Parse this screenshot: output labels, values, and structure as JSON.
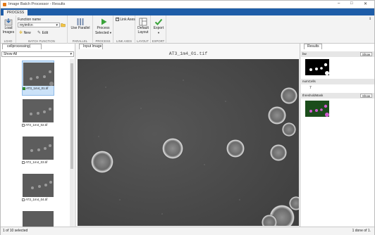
{
  "window": {
    "title": "Image Batch Processor - Results"
  },
  "toolstrip_tab": "PROCESS",
  "ribbon": {
    "load": {
      "button": "Load Images",
      "section": "LOAD"
    },
    "batch_function": {
      "label": "Function name",
      "value": "myimfcn",
      "new": "New",
      "edit": "Edit",
      "section": "BATCH FUNCTION"
    },
    "parallel": {
      "button": "Use Parallel",
      "section": "PARALLEL"
    },
    "process": {
      "button": "Process Selected",
      "section": "PROCESS"
    },
    "link_axes": {
      "label": "Link Axes",
      "checked": true,
      "section": "LINK AXES"
    },
    "layout": {
      "button": "Default Layout",
      "section": "LAYOUT"
    },
    "export": {
      "button": "Export",
      "section": "EXPORT"
    }
  },
  "left_panel": {
    "tab": "cellprocessing|",
    "filter": "Show All",
    "thumbnails": [
      {
        "caption": "AT3_1m4_01.tif",
        "selected": true
      },
      {
        "caption": "AT3_1m4_02.tif",
        "selected": false
      },
      {
        "caption": "AT3_1m4_03.tif",
        "selected": false
      },
      {
        "caption": "AT3_1m4_04.tif",
        "selected": false
      },
      {
        "caption": "",
        "selected": false
      }
    ]
  },
  "center_panel": {
    "tab": "Input Image",
    "image_title": "AT3_1m4_01.tif"
  },
  "right_panel": {
    "tab": "Results",
    "rows": [
      {
        "name": "bw",
        "button": "Show"
      },
      {
        "name": "numCells",
        "value": "7"
      },
      {
        "name": "thresholdMask",
        "button": "Show"
      }
    ]
  },
  "status": {
    "left": "1 of 10 selected",
    "right": "1 done of 1."
  },
  "colors": {
    "accent": "#1e5da8",
    "selection": "#cbe2f8"
  }
}
